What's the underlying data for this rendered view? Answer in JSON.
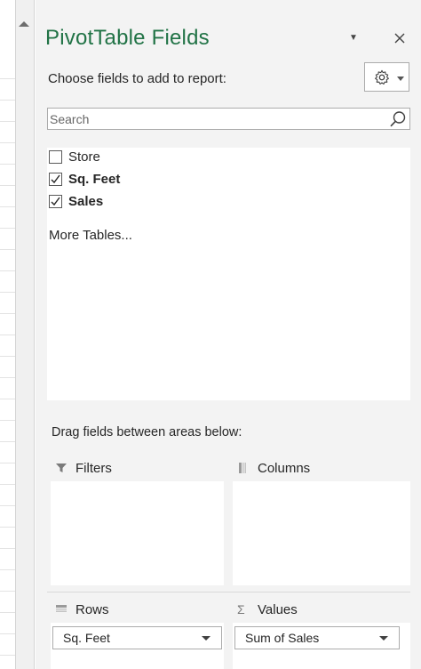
{
  "pane": {
    "title": "PivotTable Fields",
    "menu_icon": "small-down-arrow",
    "close_icon": "close-x",
    "title_color": "#217346"
  },
  "chooser": {
    "label": "Choose fields to add to report:",
    "tools_icon": "gear-icon"
  },
  "search": {
    "placeholder": "Search",
    "icon": "search-icon"
  },
  "fields": [
    {
      "label": "Store",
      "checked": false
    },
    {
      "label": "Sq. Feet",
      "checked": true
    },
    {
      "label": "Sales",
      "checked": true
    }
  ],
  "more_tables": "More Tables...",
  "drag_label": "Drag fields between areas below:",
  "areas": {
    "filters": {
      "title": "Filters",
      "icon": "funnel-icon"
    },
    "columns": {
      "title": "Columns",
      "icon": "columns-icon"
    },
    "rows": {
      "title": "Rows",
      "icon": "rows-icon",
      "item": "Sq. Feet"
    },
    "values": {
      "title": "Values",
      "icon": "sigma-icon",
      "item": "Sum of Sales"
    }
  }
}
